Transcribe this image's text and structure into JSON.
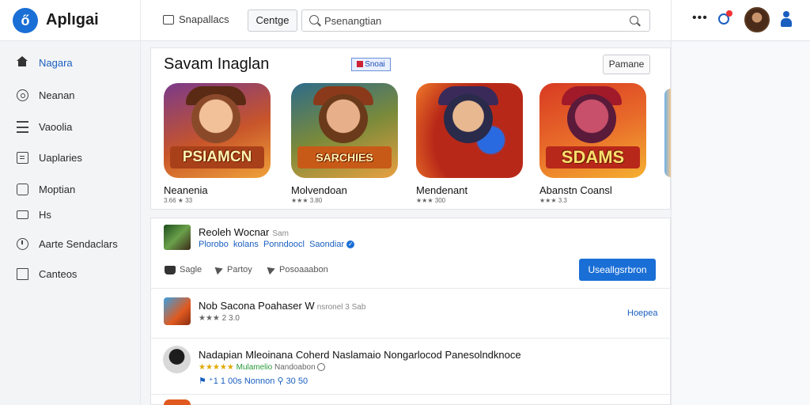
{
  "app": {
    "name": "Aplıgai",
    "logo_glyph": "ő"
  },
  "header": {
    "section_label": "Snapallacs",
    "center_button": "Centge",
    "search_placeholder": "Psenangtian",
    "more_glyph": "•••"
  },
  "sidebar": {
    "items": [
      {
        "label": "Nagara",
        "icon": "home-icon",
        "active": true
      },
      {
        "label": "Neanan",
        "icon": "circle-icon",
        "active": false
      },
      {
        "label": "Vaoolia",
        "icon": "grid-icon",
        "active": false
      },
      {
        "label": "Uaplaries",
        "icon": "box-icon",
        "active": false
      },
      {
        "label": "Moptian",
        "icon": "pin-icon",
        "active": false
      },
      {
        "label": "Hs",
        "icon": "image-icon",
        "active": false
      },
      {
        "label": "Aarte Sendaclars",
        "icon": "clock-icon",
        "active": false
      },
      {
        "label": "Canteos",
        "icon": "doc-icon",
        "active": false
      }
    ]
  },
  "featured": {
    "title": "Savam Inaglan",
    "chip": "Snoai",
    "button": "Pamane",
    "games": [
      {
        "banner": "PSIAMCN",
        "title": "Neanenia",
        "meta": "3.66 ★ 33",
        "colors": [
          "#7a3a8a",
          "#f0a23a"
        ]
      },
      {
        "banner": "SARCHIES",
        "title": "Molvendoan",
        "meta": "★★★ 3.80",
        "colors": [
          "#2d6b8a",
          "#e8a040"
        ]
      },
      {
        "banner": "",
        "title": "Mendenant",
        "meta": "★★★ 300",
        "colors": [
          "#b82818",
          "#f07a2a"
        ]
      },
      {
        "banner": "SDAMS",
        "title": "Abanstn Coansl",
        "meta": "★★★ 3.3",
        "colors": [
          "#d83a22",
          "#f5b030"
        ]
      }
    ]
  },
  "list": {
    "row1": {
      "title": "Reoleh Wocnar",
      "title_sub": "Sam",
      "links": [
        "Plorobo",
        "kolans",
        "Ponndoocl",
        "Saondiar"
      ],
      "actions": [
        "Sagle",
        "Partoy",
        "Posoaaabon"
      ],
      "primary_button": "Useallgsrbron"
    },
    "row2": {
      "title": "Nob Sacona Poahaser W",
      "title_sub": "nsronel 3 Sab",
      "meta": "★★★ 2 3.0",
      "link": "Hoepea"
    },
    "row3": {
      "title": "Nadapian Mleoinana Coherd Naslamaio Nongarlocod Panesolndknoce",
      "meta_stars": "★★★★★",
      "meta_green": "Mulamelio",
      "meta_grey": "Nandoabon",
      "stats": "⚑ ⁺1 1 00s   Nonnon   ⚲ 30 50"
    }
  },
  "colors": {
    "accent": "#1a6fd6",
    "link": "#1a5fbf",
    "star": "#e0a800"
  }
}
